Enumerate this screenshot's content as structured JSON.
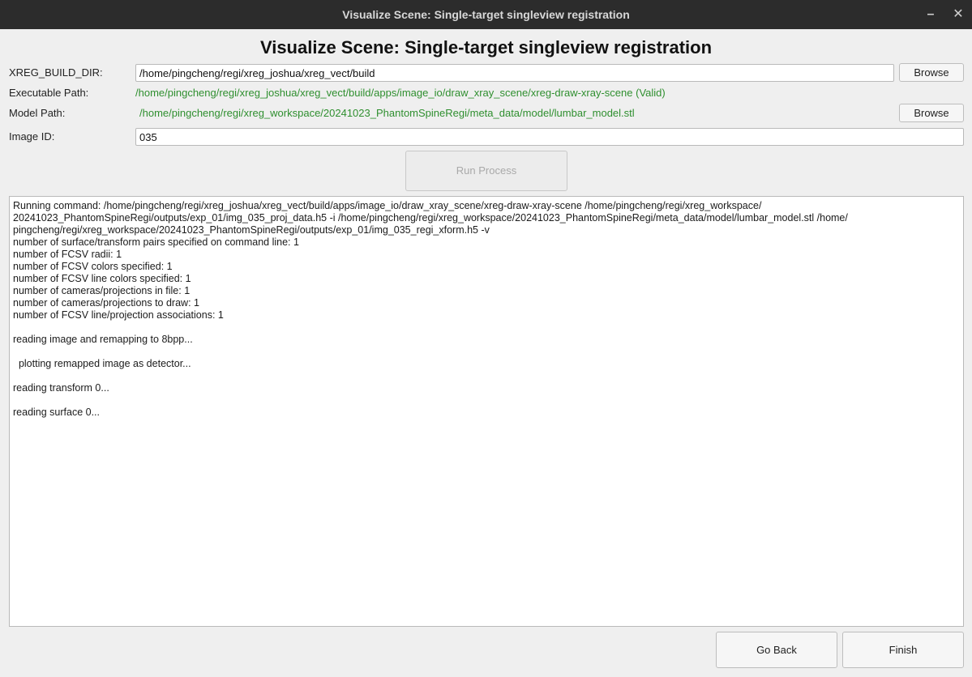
{
  "window": {
    "title": "Visualize Scene: Single-target singleview registration",
    "minimize_glyph": "–",
    "close_glyph": "✕"
  },
  "heading": "Visualize Scene: Single-target singleview registration",
  "form": {
    "build_dir_label": "XREG_BUILD_DIR:",
    "build_dir_value": "/home/pingcheng/regi/xreg_joshua/xreg_vect/build",
    "browse_label": "Browse",
    "exec_label": "Executable Path:",
    "exec_value": "/home/pingcheng/regi/xreg_joshua/xreg_vect/build/apps/image_io/draw_xray_scene/xreg-draw-xray-scene (Valid)",
    "model_label": "Model Path:",
    "model_value": "/home/pingcheng/regi/xreg_workspace/20241023_PhantomSpineRegi/meta_data/model/lumbar_model.stl",
    "image_id_label": "Image ID:",
    "image_id_value": "035",
    "run_label": "Run Process"
  },
  "output_lines": [
    "Running command: /home/pingcheng/regi/xreg_joshua/xreg_vect/build/apps/image_io/draw_xray_scene/xreg-draw-xray-scene /home/pingcheng/regi/xreg_workspace/",
    "20241023_PhantomSpineRegi/outputs/exp_01/img_035_proj_data.h5 -i /home/pingcheng/regi/xreg_workspace/20241023_PhantomSpineRegi/meta_data/model/lumbar_model.stl /home/",
    "pingcheng/regi/xreg_workspace/20241023_PhantomSpineRegi/outputs/exp_01/img_035_regi_xform.h5 -v",
    "number of surface/transform pairs specified on command line: 1",
    "number of FCSV radii: 1",
    "number of FCSV colors specified: 1",
    "number of FCSV line colors specified: 1",
    "number of cameras/projections in file: 1",
    "number of cameras/projections to draw: 1",
    "number of FCSV line/projection associations: 1",
    "",
    "reading image and remapping to 8bpp...",
    "",
    "  plotting remapped image as detector...",
    "",
    "reading transform 0...",
    "",
    "reading surface 0..."
  ],
  "footer": {
    "go_back_label": "Go Back",
    "finish_label": "Finish"
  },
  "colors": {
    "titlebar_bg": "#2c2c2c",
    "valid_path_green": "#2f8f2f",
    "window_bg": "#efefef"
  }
}
